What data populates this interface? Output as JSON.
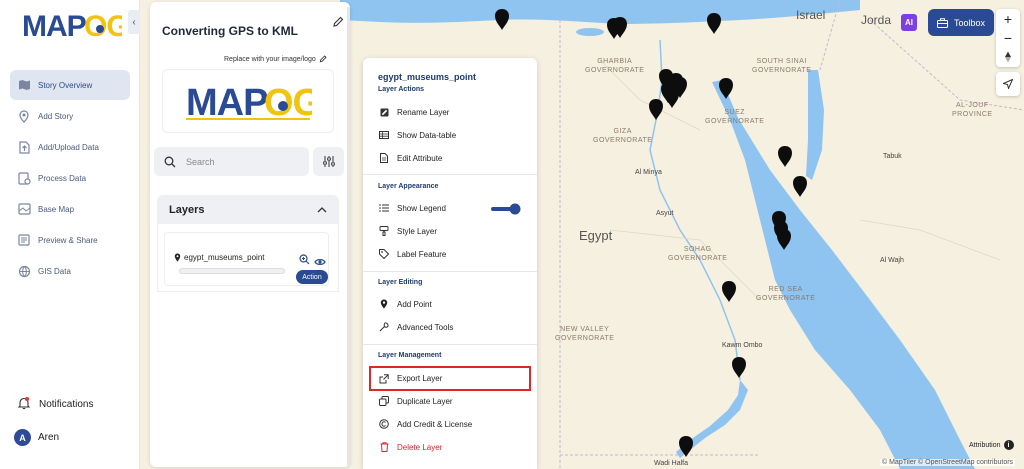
{
  "app": {
    "name": "MAPOG"
  },
  "sidebar": {
    "items": [
      {
        "label": "Story Overview",
        "icon": "map-icon",
        "active": true
      },
      {
        "label": "Add Story",
        "icon": "pin-icon"
      },
      {
        "label": "Add/Upload Data",
        "icon": "upload-icon"
      },
      {
        "label": "Process Data",
        "icon": "process-icon"
      },
      {
        "label": "Base Map",
        "icon": "basemap-icon"
      },
      {
        "label": "Preview & Share",
        "icon": "preview-icon"
      },
      {
        "label": "GIS Data",
        "icon": "gis-data-icon"
      }
    ],
    "notifications_label": "Notifications",
    "user": {
      "initial": "A",
      "name": "Aren"
    }
  },
  "story": {
    "title": "Converting GPS to KML",
    "replace_logo_label": "Replace with your image/logo",
    "search_placeholder": "Search",
    "layers_header": "Layers",
    "layer": {
      "name": "egypt_museums_point",
      "action_label": "Action"
    }
  },
  "menu": {
    "title": "egypt_museums_point",
    "sections": {
      "actions": "Layer Actions",
      "appearance": "Layer Appearance",
      "editing": "Layer Editing",
      "management": "Layer Management"
    },
    "items": {
      "rename": "Rename Layer",
      "datatable": "Show Data-table",
      "edit_attr": "Edit Attribute",
      "legend": "Show Legend",
      "style": "Style Layer",
      "label": "Label Feature",
      "add_point": "Add Point",
      "advanced": "Advanced Tools",
      "export": "Export Layer",
      "duplicate": "Duplicate Layer",
      "credit": "Add Credit & License",
      "delete": "Delete Layer"
    },
    "legend_on": true,
    "highlighted_item": "Export Layer"
  },
  "toolbar": {
    "ai_label": "AI",
    "toolbox_label": "Toolbox"
  },
  "map": {
    "country_label": "Egypt",
    "top_labels": {
      "israel": "Israel",
      "jordan": "Jorda"
    },
    "regions": {
      "gharbia": "GHARBIA\nGOVERNORATE",
      "south_sinai": "SOUTH SINAI\nGOVERNORATE",
      "giza": "GIZA\nGOVERNORATE",
      "suez": "SUEZ\nGOVERNORATE",
      "al_jouf": "AL-JOUF\nPROVINCE",
      "sohag": "SOHAG\nGOVERNORATE",
      "red_sea": "RED SEA\nGOVERNORATE",
      "new_valley": "NEW VALLEY\nGOVERNORATE"
    },
    "cities": {
      "al_minya": "Al Minya",
      "asyut": "Asyut",
      "tabuk": "Tabuk",
      "al_wajh": "Al Wajh",
      "kawm_ombo": "Kawm Ombo",
      "wadi_halfa": "Wadi Halfa"
    },
    "attribution_label": "Attribution",
    "copyright": "© MapTiler © OpenStreetMap contributors",
    "colors": {
      "land": "#f5efe0",
      "water": "#8fc4f0",
      "accent": "#2a4a94",
      "highlight": "#e02727"
    }
  }
}
